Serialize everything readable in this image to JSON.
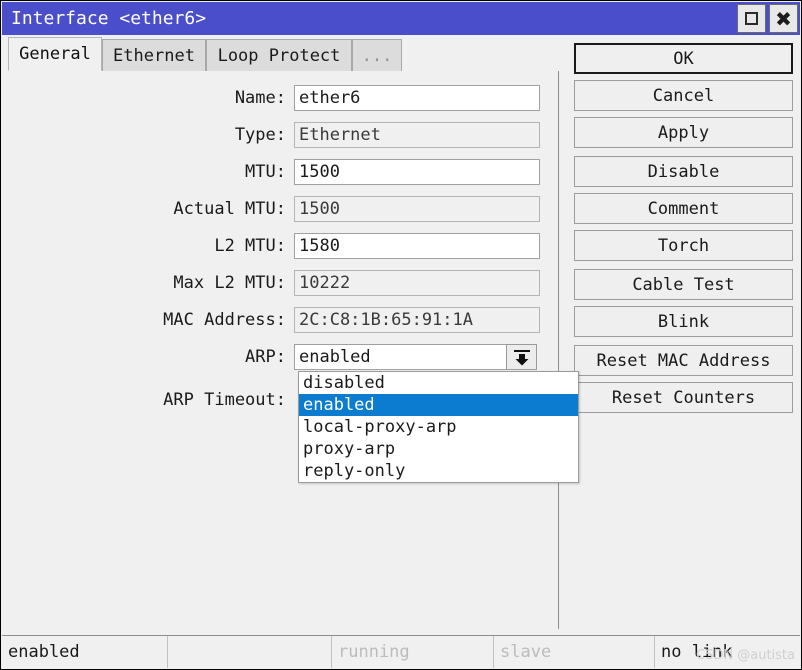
{
  "window": {
    "title": "Interface <ether6>",
    "maximize_icon": "maximize-icon",
    "close_icon": "close-icon"
  },
  "tabs": [
    {
      "label": "General",
      "active": true
    },
    {
      "label": "Ethernet",
      "active": false
    },
    {
      "label": "Loop Protect",
      "active": false
    },
    {
      "label": "...",
      "active": false,
      "dim": true
    }
  ],
  "form": {
    "fields": [
      {
        "label": "Name:",
        "value": "ether6",
        "readonly": false
      },
      {
        "label": "Type:",
        "value": "Ethernet",
        "readonly": true
      },
      {
        "label": "MTU:",
        "value": "1500",
        "readonly": false
      },
      {
        "label": "Actual MTU:",
        "value": "1500",
        "readonly": true
      },
      {
        "label": "L2 MTU:",
        "value": "1580",
        "readonly": false
      },
      {
        "label": "Max L2 MTU:",
        "value": "10222",
        "readonly": true
      },
      {
        "label": "MAC Address:",
        "value": "2C:C8:1B:65:91:1A",
        "readonly": true
      }
    ],
    "arp": {
      "label": "ARP:",
      "value": "enabled",
      "dropdown_icon": "chevron-down-icon",
      "options": [
        {
          "label": "disabled",
          "selected": false
        },
        {
          "label": "enabled",
          "selected": true
        },
        {
          "label": "local-proxy-arp",
          "selected": false
        },
        {
          "label": "proxy-arp",
          "selected": false
        },
        {
          "label": "reply-only",
          "selected": false
        }
      ]
    },
    "arp_timeout": {
      "label": "ARP Timeout:",
      "value": ""
    }
  },
  "buttons": [
    {
      "label": "OK",
      "primary": true,
      "gap": false
    },
    {
      "label": "Cancel",
      "primary": false,
      "gap": false
    },
    {
      "label": "Apply",
      "primary": false,
      "gap": false
    },
    {
      "label": "Disable",
      "primary": false,
      "gap": true
    },
    {
      "label": "Comment",
      "primary": false,
      "gap": false
    },
    {
      "label": "Torch",
      "primary": false,
      "gap": false
    },
    {
      "label": "Cable Test",
      "primary": false,
      "gap": true
    },
    {
      "label": "Blink",
      "primary": false,
      "gap": false
    },
    {
      "label": "Reset MAC Address",
      "primary": false,
      "gap": true
    },
    {
      "label": "Reset Counters",
      "primary": false,
      "gap": false
    }
  ],
  "statusbar": [
    {
      "text": "enabled",
      "dim": false,
      "width": 166
    },
    {
      "text": "",
      "dim": false,
      "width": 164
    },
    {
      "text": "running",
      "dim": true,
      "width": 162
    },
    {
      "text": "slave",
      "dim": true,
      "width": 161
    },
    {
      "text": "no link",
      "dim": false,
      "width": 145
    }
  ],
  "watermark": "CSDN @autista",
  "colors": {
    "titlebar": "#4a4ecb",
    "selection": "#0c7cd0",
    "window_bg": "#f0f0f0",
    "field_bg": "#ffffff"
  }
}
